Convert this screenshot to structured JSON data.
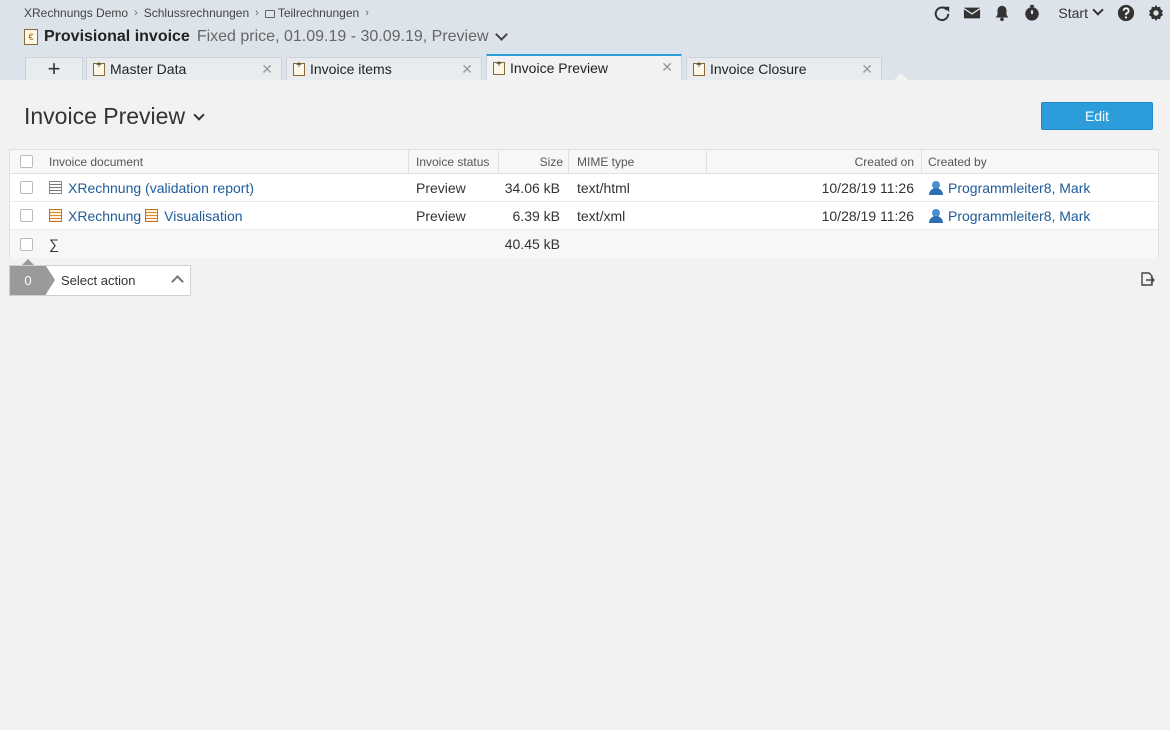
{
  "breadcrumb": {
    "items": [
      "XRechnungs Demo",
      "Schlussrechnungen",
      "Teilrechnungen"
    ]
  },
  "header": {
    "title": "Provisional invoice",
    "subtitle": "Fixed price, 01.09.19 - 30.09.19, Preview",
    "start_label": "Start"
  },
  "toolbar": {
    "icons": [
      "refresh-icon",
      "mail-icon",
      "bell-icon",
      "stopwatch-icon",
      "help-icon",
      "gear-icon"
    ]
  },
  "tabs": [
    {
      "label": "Master Data",
      "active": false
    },
    {
      "label": "Invoice items",
      "active": false
    },
    {
      "label": "Invoice Preview",
      "active": true
    },
    {
      "label": "Invoice Closure",
      "active": false
    }
  ],
  "page": {
    "title": "Invoice Preview",
    "edit_label": "Edit"
  },
  "table": {
    "columns": {
      "document": "Invoice document",
      "status": "Invoice status",
      "size": "Size",
      "mime": "MIME type",
      "created_on": "Created on",
      "created_by": "Created by"
    },
    "rows": [
      {
        "document": "XRechnung (validation report)",
        "document_extra": "",
        "status": "Preview",
        "size": "34.06 kB",
        "mime": "text/html",
        "created_on": "10/28/19 11:26",
        "created_by": "Programmleiter8, Mark"
      },
      {
        "document": "XRechnung",
        "document_extra": "Visualisation",
        "status": "Preview",
        "size": "6.39 kB",
        "mime": "text/xml",
        "created_on": "10/28/19 11:26",
        "created_by": "Programmleiter8, Mark"
      }
    ],
    "sum_symbol": "∑",
    "sum_size": "40.45 kB"
  },
  "actions": {
    "count": "0",
    "label": "Select action"
  },
  "colors": {
    "accent": "#2d9cdb",
    "link": "#1e5b9a",
    "header_bg": "#dde3ea"
  }
}
